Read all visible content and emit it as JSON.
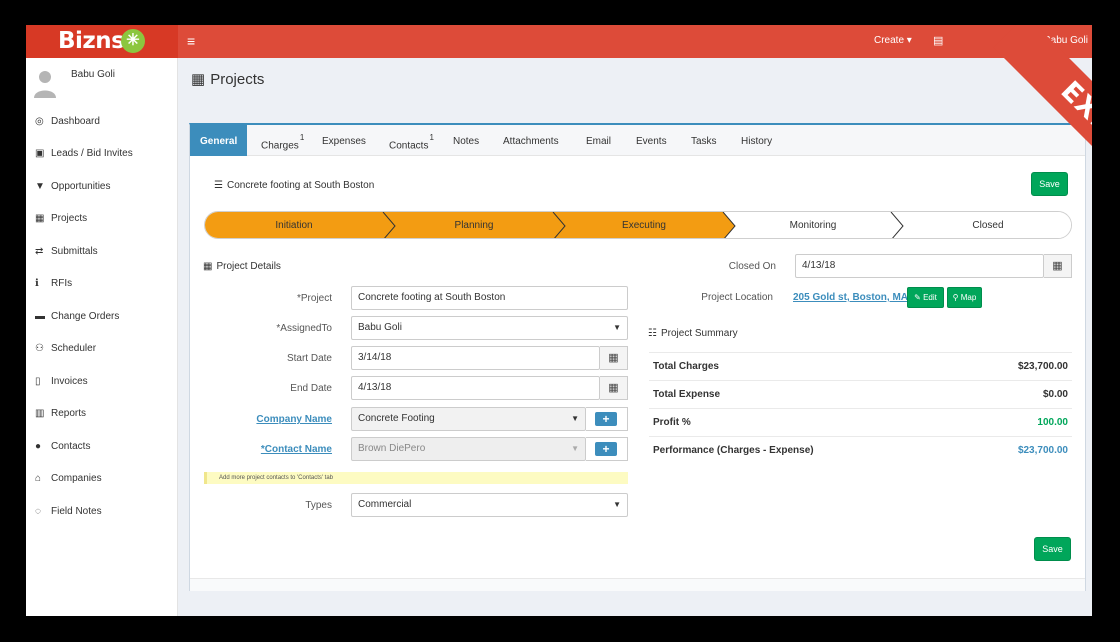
{
  "app": {
    "brand": "Bizns",
    "brand_mark": "✳",
    "create_label": "Create",
    "user_name": "Babu Goli",
    "accent": "#dd4b39",
    "primary": "#3c8dbc",
    "success": "#00a65a"
  },
  "sidebar": {
    "user_name": "Babu Goli",
    "items": [
      {
        "label": "Dashboard",
        "icon": "dashboard-icon",
        "glyph": "◎"
      },
      {
        "label": "Leads / Bid Invites",
        "icon": "leads-icon",
        "glyph": "▣"
      },
      {
        "label": "Opportunities",
        "icon": "filter-icon",
        "glyph": "▼"
      },
      {
        "label": "Projects",
        "icon": "briefcase-icon",
        "glyph": "▦"
      },
      {
        "label": "Submittals",
        "icon": "exchange-icon",
        "glyph": "⇄"
      },
      {
        "label": "RFIs",
        "icon": "info-icon",
        "glyph": "ℹ"
      },
      {
        "label": "Change Orders",
        "icon": "folder-icon",
        "glyph": "▬"
      },
      {
        "label": "Scheduler",
        "icon": "users-icon",
        "glyph": "⚇"
      },
      {
        "label": "Invoices",
        "icon": "file-icon",
        "glyph": "▯"
      },
      {
        "label": "Reports",
        "icon": "bar-chart-icon",
        "glyph": "▥"
      },
      {
        "label": "Contacts",
        "icon": "user-icon",
        "glyph": "●"
      },
      {
        "label": "Companies",
        "icon": "building-icon",
        "glyph": "⌂"
      },
      {
        "label": "Field Notes",
        "icon": "comment-icon",
        "glyph": "◌"
      }
    ]
  },
  "page": {
    "title": "Projects",
    "ribbon": "EXECUTE"
  },
  "tabs": [
    {
      "label": "General",
      "badge": ""
    },
    {
      "label": "Charges",
      "badge": "1"
    },
    {
      "label": "Expenses",
      "badge": ""
    },
    {
      "label": "Contacts",
      "badge": "1"
    },
    {
      "label": "Notes",
      "badge": ""
    },
    {
      "label": "Attachments",
      "badge": ""
    },
    {
      "label": "Email",
      "badge": ""
    },
    {
      "label": "Events",
      "badge": ""
    },
    {
      "label": "Tasks",
      "badge": ""
    },
    {
      "label": "History",
      "badge": ""
    }
  ],
  "project": {
    "heading": "Concrete footing at South Boston",
    "save_label": "Save",
    "stages": [
      "Initiation",
      "Planning",
      "Executing",
      "Monitoring",
      "Closed"
    ],
    "completed_stages": 3,
    "details_title": "Project Details",
    "fields": {
      "project_label": "*Project",
      "project_value": "Concrete footing at South Boston",
      "assigned_label": "*AssignedTo",
      "assigned_value": "Babu Goli",
      "start_label": "Start Date",
      "start_value": "3/14/18",
      "end_label": "End Date",
      "end_value": "4/13/18",
      "company_label": "Company Name",
      "company_value": "Concrete Footing",
      "contact_label": "*Contact Name",
      "contact_value": "Brown DiePero",
      "types_label": "Types",
      "types_value": "Commercial"
    },
    "hint": "Add more project contacts to 'Contacts' tab",
    "closed_label": "Closed On",
    "closed_value": "4/13/18",
    "location_label": "Project Location",
    "location_value": "205 Gold st, Boston, MA, ,",
    "edit_label": "Edit",
    "map_label": "Map",
    "summary_title": "Project Summary",
    "summary": [
      {
        "label": "Total Charges",
        "value": "$23,700.00",
        "color": "#333333"
      },
      {
        "label": "Total Expense",
        "value": "$0.00",
        "color": "#333333"
      },
      {
        "label": "Profit %",
        "value": "100.00",
        "color": "#00a65a"
      },
      {
        "label": "Performance (Charges - Expense)",
        "value": "$23,700.00",
        "color": "#3c8dbc"
      }
    ]
  }
}
